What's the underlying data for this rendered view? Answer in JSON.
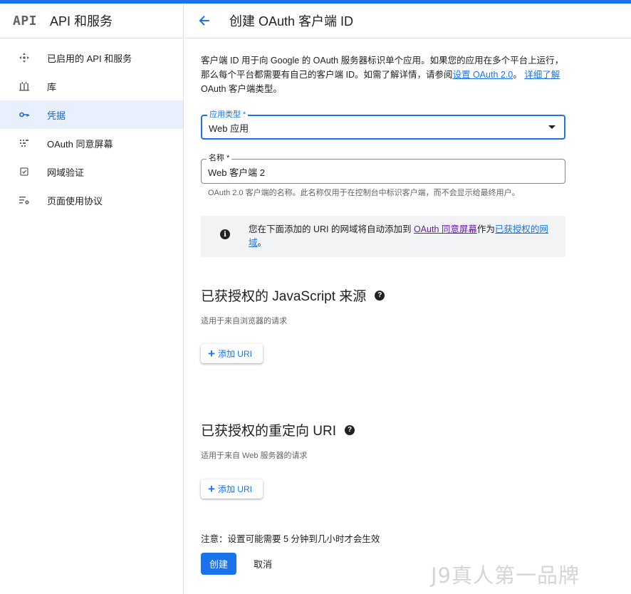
{
  "sidebar": {
    "logo": "API",
    "title": "API 和服务",
    "items": [
      {
        "label": "已启用的 API 和服务",
        "icon": "dashboard-icon"
      },
      {
        "label": "库",
        "icon": "library-icon"
      },
      {
        "label": "凭据",
        "icon": "key-icon"
      },
      {
        "label": "OAuth 同意屏幕",
        "icon": "consent-icon"
      },
      {
        "label": "网域验证",
        "icon": "checkbox-icon"
      },
      {
        "label": "页面使用协议",
        "icon": "settings-list-icon"
      }
    ],
    "active_index": 2
  },
  "header": {
    "title": "创建 OAuth 客户端 ID"
  },
  "intro": {
    "text1": "客户端 ID 用于向 Google 的 OAuth 服务器标识单个应用。如果您的应用在多个平台上运行，那么每个平台都需要有自己的客户端 ID。如需了解详情，请参阅",
    "link1": "设置 OAuth 2.0",
    "text2": "。",
    "link2": "详细了解",
    "text3": " OAuth 客户端类型。"
  },
  "app_type": {
    "label": "应用类型 *",
    "value": "Web 应用"
  },
  "name_field": {
    "label": "名称 *",
    "value": "Web 客户端 2",
    "hint": "OAuth 2.0 客户端的名称。此名称仅用于在控制台中标识客户端，而不会显示给最终用户。"
  },
  "info": {
    "text1": "您在下面添加的 URI 的网域将自动添加到 ",
    "link1": "OAuth 同意屏幕",
    "text2": "作为",
    "link2": "已获授权的网域",
    "text3": "。"
  },
  "js_origins": {
    "title": "已获授权的 JavaScript 来源",
    "subtitle": "适用于来自浏览器的请求",
    "add_label": "添加 URI"
  },
  "redirect_uris": {
    "title": "已获授权的重定向 URI",
    "subtitle": "适用于来自 Web 服务器的请求",
    "add_label": "添加 URI"
  },
  "footer": {
    "note": "注意：设置可能需要 5 分钟到几小时才会生效",
    "create_label": "创建",
    "cancel_label": "取消"
  },
  "watermark": "J9真人第一品牌",
  "colors": {
    "accent": "#1a73e8",
    "active_bg": "#e8f0fe",
    "visited_link": "#681da8"
  }
}
